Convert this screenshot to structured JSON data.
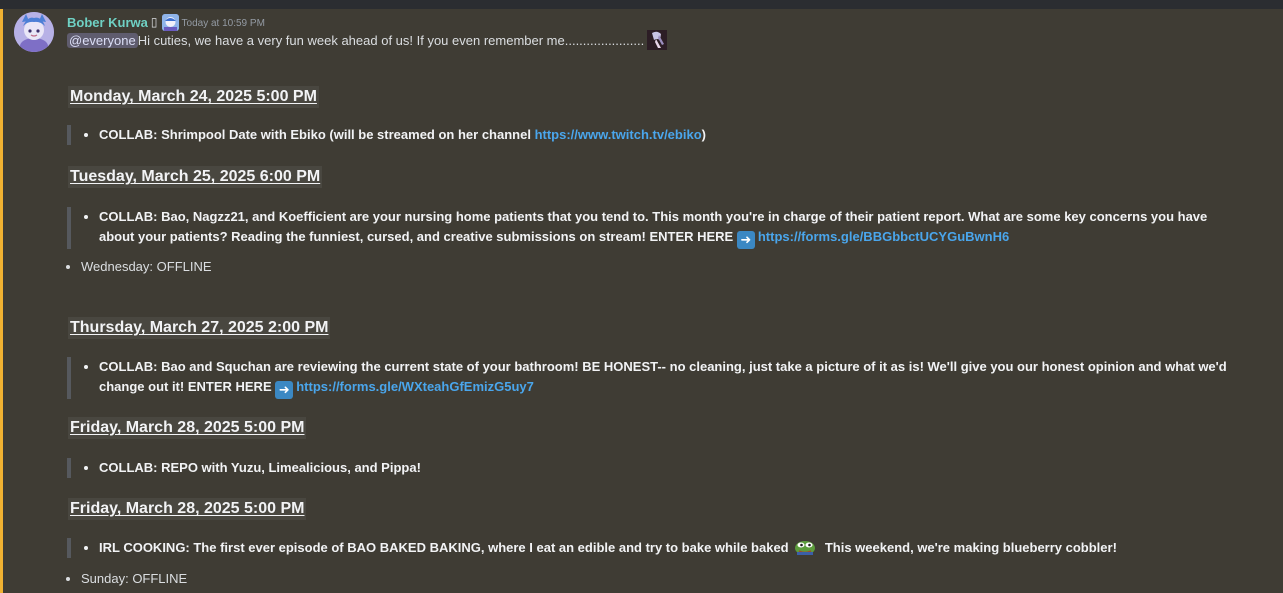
{
  "message": {
    "author": "Bober Kurwa",
    "author_glyph": "▯",
    "timestamp": "Today at 10:59 PM",
    "mention": "@everyone",
    "intro_text": " Hi cuties, we have a very fun week ahead of us! If you even remember me......................",
    "colors": {
      "author": "#6fd1c4",
      "link": "#4aa6ec",
      "mention_bar": "#f0b232",
      "background": "#3f3c34"
    }
  },
  "schedule": [
    {
      "heading": " Monday, March 24, 2025 5:00 PM",
      "item_text": "COLLAB: Shrimpool Date with Ebiko (will be streamed on her channel ",
      "link": "https://www.twitch.tv/ebiko",
      "item_suffix": ")"
    },
    {
      "heading": "Tuesday, March 25, 2025 6:00 PM",
      "item_text": "COLLAB: Bao, Nagzz21, and Koefficient are your nursing home patients that you tend to. This month you're in charge of their patient report. What are some key concerns you have about your patients? Reading the funniest, cursed, and creative submissions on stream! ENTER HERE ",
      "emoji": "arrow-right-emoji",
      "link": "https://forms.gle/BBGbbctUCYGuBwnH6"
    },
    {
      "offline": "Wednesday: OFFLINE"
    },
    {
      "heading": "Thursday, March 27, 2025 2:00 PM",
      "item_text": "COLLAB: Bao and Squchan are reviewing the current state of your bathroom! BE HONEST-- no cleaning, just take a picture of it as is! We'll give you our honest opinion and what we'd change out it! ENTER HERE ",
      "emoji": "arrow-right-emoji",
      "link": "https://forms.gle/WXteahGfEmizG5uy7"
    },
    {
      "heading": "Friday, March 28, 2025 5:00 PM",
      "item_text": "COLLAB: REPO with Yuzu, Limealicious, and Pippa!"
    },
    {
      "heading": "Friday, March 28, 2025 5:00 PM",
      "item_text": "IRL COOKING: The first ever episode of BAO BAKED BAKING, where I eat an edible and try to bake while baked ",
      "emoji": "pepe-emoji",
      "item_suffix": " This weekend, we're making blueberry cobbler!"
    },
    {
      "offline": "Sunday: OFFLINE"
    }
  ]
}
